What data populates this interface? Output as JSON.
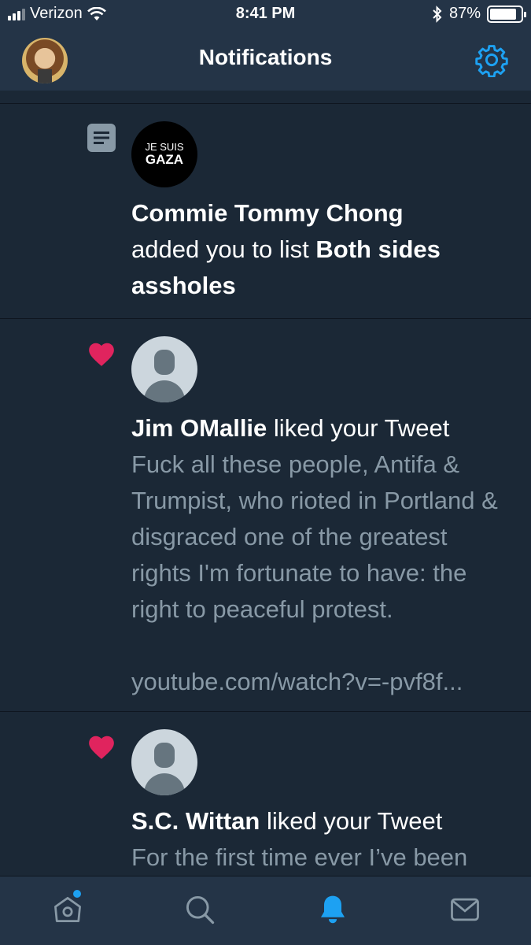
{
  "status_bar": {
    "carrier": "Verizon",
    "time": "8:41 PM",
    "battery": "87%",
    "battery_level": 0.87,
    "icons": [
      "signal-bars-icon",
      "wifi-icon",
      "bluetooth-icon",
      "battery-icon"
    ]
  },
  "header": {
    "title": "Notifications",
    "settings_icon": "gear-icon"
  },
  "notifications": [
    {
      "type": "list_add",
      "icon": "list-icon",
      "avatar_line1": "JE SUIS",
      "avatar_line2": "GAZA",
      "actor": "Commie Tommy Chong",
      "action": "added you to list",
      "list_name": "Both sides assholes"
    },
    {
      "type": "like",
      "icon": "heart-icon",
      "actor": "Jim OMallie",
      "action": "liked your Tweet",
      "tweet_text": "Fuck all these people, Antifa & Trumpist, who rioted in Portland & disgraced one of the greatest rights I'm fortunate to have: the right to peaceful protest.",
      "tweet_link": "youtube.com/watch?v=-pvf8f..."
    },
    {
      "type": "like",
      "icon": "heart-icon",
      "actor": "S.C. Wittan",
      "action": "liked your Tweet",
      "tweet_text": "For the first time ever I’ve been called a “fascist” on Twitter"
    }
  ],
  "tab_bar": {
    "tabs": [
      "home-icon",
      "search-icon",
      "notifications-bell-icon",
      "messages-icon"
    ],
    "active": "notifications-bell-icon",
    "home_has_new": true
  },
  "colors": {
    "background": "#1b2836",
    "bars": "#243447",
    "accent": "#1da1f2",
    "like": "#e0245e",
    "secondary_text": "#8899a6"
  }
}
